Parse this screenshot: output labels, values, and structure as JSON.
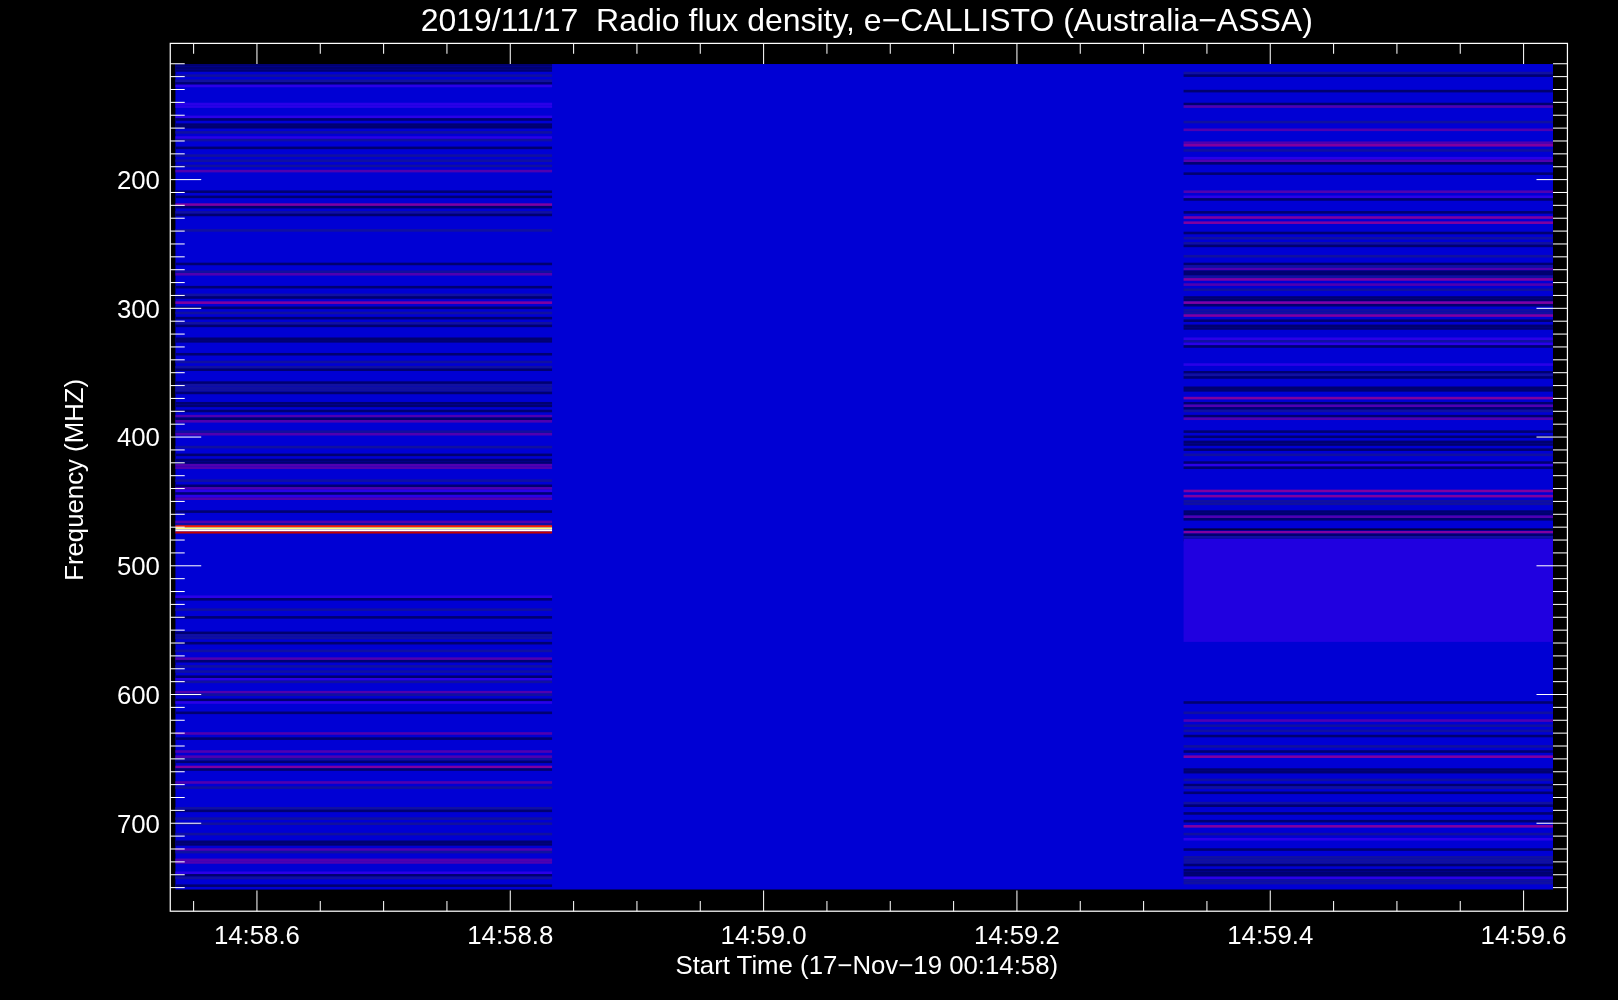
{
  "title": "2019/11/17  Radio flux density, e−CALLISTO (Australia−ASSA)",
  "x_axis": {
    "label": "Start Time (17−Nov−19 00:14:58)",
    "ticks": [
      "14:58.6",
      "14:58.8",
      "14:59.0",
      "14:59.2",
      "14:59.4",
      "14:59.6"
    ]
  },
  "y_axis": {
    "label": "Frequency (MHZ)",
    "ticks": [
      "200",
      "300",
      "400",
      "500",
      "600",
      "700"
    ]
  }
}
